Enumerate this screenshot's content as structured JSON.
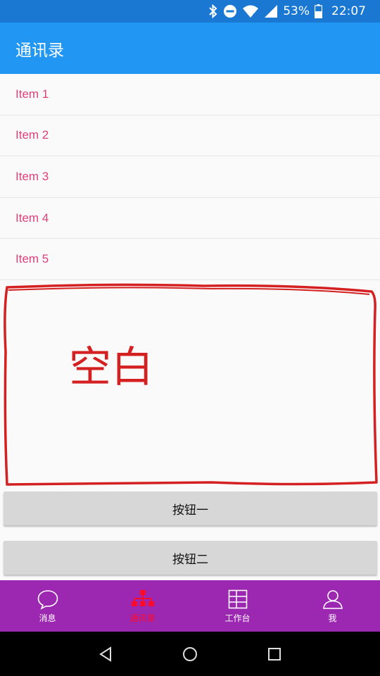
{
  "status_bar": {
    "battery": "53%",
    "time": "22:07",
    "icons": [
      "bluetooth-icon",
      "do-not-disturb-icon",
      "wifi-icon",
      "signal-icon",
      "battery-icon"
    ]
  },
  "app_bar": {
    "title": "通讯录"
  },
  "list": {
    "items": [
      "Item 1",
      "Item 2",
      "Item 3",
      "Item 4",
      "Item 5"
    ]
  },
  "blank_area": {
    "annotation": "空白",
    "annotation_color": "#d42020"
  },
  "buttons": {
    "button_one": "按钮一",
    "button_two": "按钮二"
  },
  "bottom_nav": {
    "items": [
      {
        "label": "消息",
        "icon": "chat-bubble-icon"
      },
      {
        "label": "通讯录",
        "icon": "org-chart-icon",
        "active": true
      },
      {
        "label": "工作台",
        "icon": "grid-icon"
      },
      {
        "label": "我",
        "icon": "person-icon"
      }
    ],
    "active_color": "#ff0a28",
    "background": "#9c27b0"
  },
  "colors": {
    "status_bar": "#1a78d2",
    "app_bar": "#2196f3",
    "list_text": "#e0407a",
    "button_bg": "#d7d7d7"
  }
}
